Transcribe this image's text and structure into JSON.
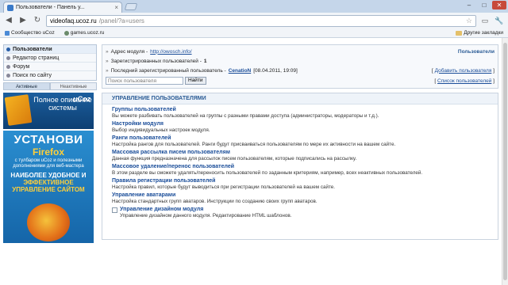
{
  "browser": {
    "tab_title": "Пользователи - Панель у...",
    "tab_close": "×",
    "url_host": "videofaq.ucoz.ru",
    "url_path": "/panel/?a=users",
    "window_minimize": "–",
    "window_maximize": "□",
    "window_close": "✕",
    "back": "◀",
    "forward": "▶",
    "reload": "↻",
    "star": "☆",
    "page_menu": "▭",
    "tools_menu": "🔧",
    "bookmarks": [
      "Сообщество uCoz",
      "games.ucoz.ru"
    ],
    "other_bookmarks": "Другие закладки"
  },
  "sidebar": {
    "menu": [
      {
        "label": "Пользователи",
        "active": true
      },
      {
        "label": "Редактор страниц",
        "active": false
      },
      {
        "label": "Форум",
        "active": false
      },
      {
        "label": "Поиск по сайту",
        "active": false
      }
    ],
    "tabs": [
      "Активные",
      "Неактивные"
    ],
    "banner_top": {
      "text": "Полное описание системы",
      "logo": "uCoz"
    },
    "banner_bottom": {
      "line1": "УСТАНОВИ",
      "line2": "Firefox",
      "line3": "с тулбаром uCoz и полезными дополнениями для веб-мастера",
      "line4": "НАИБОЛЕЕ УДОБНОЕ И",
      "line5": "ЭФФЕКТИВНОЕ УПРАВЛЕНИЕ САЙТОМ"
    }
  },
  "info": {
    "module_address_label": "Адрес модуля -",
    "module_address_link": "http://owosch.info/",
    "section_title": "Пользователи",
    "registered_label": "Зарегистрированных пользователей -",
    "registered_count": "1",
    "last_registered_label": "Последний зарегистрированный пользователь -",
    "last_registered_user": "CenatioN",
    "last_registered_date": "[08.04.2011, 19:09]",
    "add_user_link": "Добавить пользователя",
    "user_list_link": "Список пользователей",
    "search_placeholder": "Поиск пользователя",
    "search_button": "Найти"
  },
  "panel": {
    "title": "УПРАВЛЕНИЕ ПОЛЬЗОВАТЕЛЯМИ",
    "options": [
      {
        "title": "Группы пользователей",
        "desc": "Вы можете разбивать пользователей на группы с разными правами доступа (администраторы, модераторы и т.д.)."
      },
      {
        "title": "Настройки модуля",
        "desc": "Выбор индивидуальных настроек модуля."
      },
      {
        "title": "Ранги пользователей",
        "desc": "Настройка рангов для пользователей. Ранги будут присваиваться пользователям по мере их активности на вашем сайте."
      },
      {
        "title": "Массовая рассылка писем пользователям",
        "desc": "Данная функция предназначена для рассылок писем пользователям, которые подписались на рассылку."
      },
      {
        "title": "Массовое удаление/перенос пользователей",
        "desc": "В этом разделе вы сможете удалять/переносить пользователей по заданным критериям, например, всех неактивных пользователей."
      },
      {
        "title": "Правила регистрации пользователей",
        "desc": "Настройка правил, которые будут выводиться при регистрации пользователей на вашем сайте."
      },
      {
        "title": "Управление аватарами",
        "desc": "Настройка стандартных групп аватаров. Инструкции по созданию своих групп аватаров."
      },
      {
        "title": "Управление дизайном модуля",
        "desc": "Управление дизайном данного модуля. Редактирование HTML шаблонов."
      }
    ]
  }
}
